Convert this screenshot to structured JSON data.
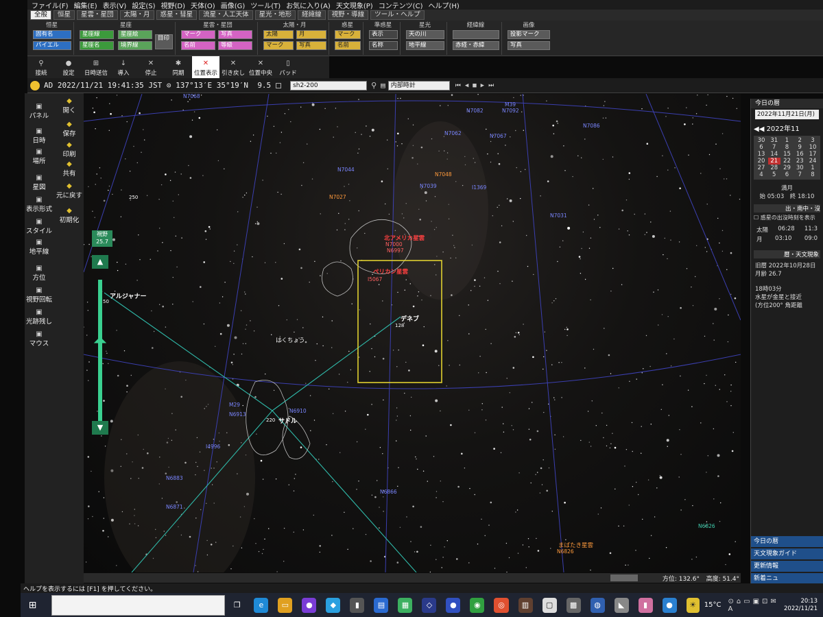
{
  "menu": [
    "ファイル(F)",
    "編集(E)",
    "表示(V)",
    "設定(S)",
    "視野(D)",
    "天体(O)",
    "画像(G)",
    "ツール(T)",
    "お気に入り(A)",
    "天文現象(P)",
    "コンテンツ(C)",
    "ヘルプ(H)"
  ],
  "tabs": [
    "全般",
    "恒星",
    "星雲・星団",
    "太陽・月",
    "惑星・彗星",
    "流星・人工天体",
    "星光・地形",
    "経緯線",
    "視野・導線",
    "ツール・ヘルプ"
  ],
  "ribbon": {
    "groups": [
      "恒星",
      "星座",
      "星雲・星団",
      "太陽・月",
      "惑星",
      "準惑星",
      "星光",
      "経緯線",
      "画像"
    ],
    "buttons": {
      "b1": "固有名",
      "b2": "バイエル",
      "b3": "星座線",
      "b4": "星座絵",
      "b5": "星座名",
      "b6": "境界線",
      "b7": "目印",
      "b8": "マーク",
      "b9": "写真",
      "b10": "名前",
      "b11": "等級",
      "b12": "太陽",
      "b13": "月",
      "b14": "マーク",
      "b15": "写真",
      "b16": "マーク",
      "b17": "名前",
      "b18": "表示",
      "b19": "名称",
      "b20": "天の川",
      "b21": "地平線",
      "b22": "赤経・赤緯",
      "b23": "投影マーク",
      "b24": "写真"
    }
  },
  "tools": [
    {
      "label": "接続",
      "icon": "⚲"
    },
    {
      "label": "設定",
      "icon": "●"
    },
    {
      "label": "日時送信",
      "icon": "⊞"
    },
    {
      "label": "導入",
      "icon": "↓"
    },
    {
      "label": "停止",
      "icon": "✕"
    },
    {
      "label": "同期",
      "icon": "✱"
    },
    {
      "label": "位置表示",
      "icon": "✕"
    },
    {
      "label": "引き戻し",
      "icon": "✕"
    },
    {
      "label": "位置中央",
      "icon": "✕"
    },
    {
      "label": "パッド",
      "icon": "▯"
    }
  ],
  "status": {
    "era": "AD",
    "datetime": "2022/11/21 19:41:35",
    "tz": "JST",
    "coords": "137°13′E 35°19′N",
    "mag": "9.5",
    "target": "sh2-200",
    "clock": "内部時計"
  },
  "left_buttons": [
    "パネル",
    "日時",
    "場所",
    "星図",
    "表示形式",
    "スタイル",
    "地平線",
    "方位",
    "視野回転",
    "光跡残し",
    "マウス"
  ],
  "left_buttons2": [
    "開く",
    "保存",
    "印刷",
    "共有",
    "元に戻す",
    "初期化"
  ],
  "zoom": {
    "label": "視野",
    "value": "25.7"
  },
  "sky_labels": {
    "deneb": "デネブ",
    "sadr": "サドル",
    "albireo": "アルジャナー",
    "swan": "はくちょう",
    "pelican": "ペリカン星雲",
    "namerica": "北アメリカ星雲",
    "fireworks": "まばたき星雲",
    "ngc": [
      "N7068",
      "N7082",
      "N7092",
      "M39",
      "N7062",
      "N7067",
      "N7086",
      "N7044",
      "N7048",
      "N7039",
      "I1369",
      "N7027",
      "N7031",
      "N7000",
      "N6997",
      "I5067",
      "N6910",
      "M29",
      "N6913",
      "I4996",
      "N6883",
      "N6871",
      "N6866",
      "N6826",
      "N6826"
    ],
    "mags": [
      "250",
      "50",
      "128",
      "220"
    ]
  },
  "right_panel": {
    "title": "今日の暦",
    "date": "2022年11月21日(月)",
    "month": "2022年11",
    "cal": [
      [
        "30",
        "31",
        "1",
        "2",
        "3"
      ],
      [
        "6",
        "7",
        "8",
        "9",
        "10"
      ],
      [
        "13",
        "14",
        "15",
        "16",
        "17"
      ],
      [
        "20",
        "21",
        "22",
        "23",
        "24"
      ],
      [
        "27",
        "28",
        "29",
        "30",
        "1"
      ],
      [
        "4",
        "5",
        "6",
        "7",
        "8"
      ]
    ],
    "moon_label": "満月",
    "moon_times": "始 05:03　終 18:10",
    "rise_title": "出・南中・沒",
    "rise_check": "惑星の出沒時刻を表示",
    "sun_row": [
      "太陽",
      "06:28",
      "11:3"
    ],
    "moon_row": [
      "月",
      "03:10",
      "09:0"
    ],
    "almanac_title": "暦・天文現象",
    "old_cal": "旧暦 2022年10月28日",
    "age": "月齢 26.7",
    "event1": "18時03分",
    "event2": "水星が金星と接近",
    "event3": "(方位200° 角距離",
    "nav": [
      "今日の暦",
      "天文現象ガイド",
      "更新情報",
      "新着ニュ"
    ]
  },
  "bottom_coords": {
    "az": "方位: 132.6°",
    "alt": "高度: 51.4°"
  },
  "help": "ヘルプを表示するには [F1] を押してください。",
  "taskbar": {
    "temp": "15°C",
    "time": "20:13",
    "date": "2022/11/21"
  }
}
